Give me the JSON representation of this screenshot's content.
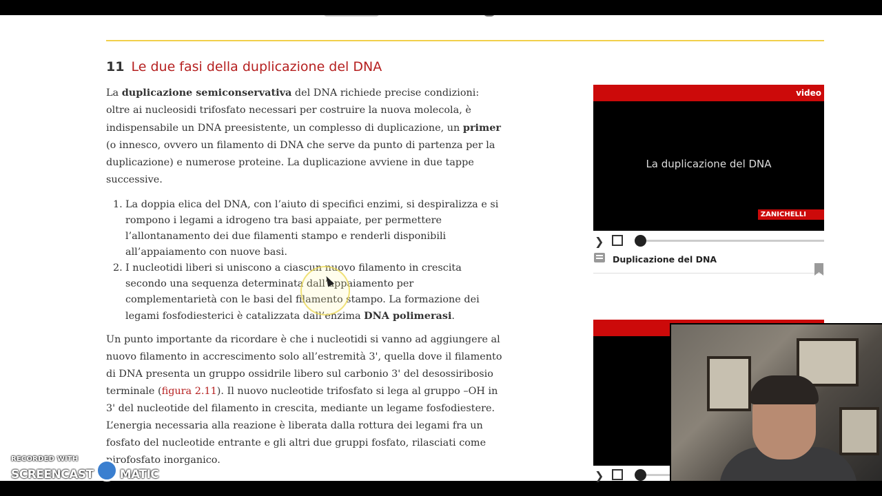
{
  "section": {
    "number": "11",
    "title": "Le due fasi della duplicazione del DNA"
  },
  "intro": {
    "part1": "La ",
    "bold1": "duplicazione semiconservativa",
    "part2": " del DNA richiede precise condizioni: oltre ai nucleosidi trifosfato necessari per costruire la nuova molecola, è indispensabile un DNA preesistente, un complesso di duplicazione, un ",
    "bold2": "primer",
    "part3": " (o innesco, ovvero un filamento di DNA che serve da punto di partenza per la duplicazione) e numerose proteine. La duplicazione avviene in due tappe successive."
  },
  "steps": [
    {
      "num": "1.",
      "text": "La doppia elica del DNA, con l’aiuto di specifici enzimi, si despiralizza e si rompono i legami a idrogeno tra basi appaiate, per permettere l’allontanamento dei due filamenti stampo e renderli disponibili all’appaiamento con nuove basi."
    },
    {
      "num": "2.",
      "text": "I nucleotidi liberi si uniscono a ciascun nuovo filamento in crescita secondo una sequenza determinata dall’appaiamento per complementarietà con le basi del filamento stampo. La formazione dei legami fosfodiesterici è catalizzata dall’enzima ",
      "bold": "DNA polimerasi",
      "end": "."
    }
  ],
  "para2": {
    "part1": "Un punto importante da ricordare è che i nucleotidi si vanno ad aggiungere al nuovo filamento in accrescimento solo all’estremità 3', quella dove il filamento di DNA presenta un gruppo ossidrile libero sul carbonio 3' del desossiribosio terminale (",
    "link": "figura 2.11",
    "part2": "). Il nuovo nucleotide trifosfato si lega al gruppo –OH in 3' del nucleotide del filamento in crescita, mediante un legame fosfodiestere. L’energia necessaria alla reazione è liberata dalla rottura dei legami fra un fosfato del nucleotide entrante e gli altri due gruppi fosfato, rilasciati come pirofosfato inorganico."
  },
  "video1": {
    "tag": "video",
    "screen_title": "La duplicazione del DNA",
    "brand": "ZANICHELLI",
    "play_glyph": "❯",
    "caption": "Duplicazione del DNA",
    "progress": 0
  },
  "video2": {
    "play_glyph": "❯",
    "progress": 0
  },
  "watermark": {
    "top": "RECORDED WITH",
    "left": "SCREENCAST",
    "right": "MATIC"
  },
  "colors": {
    "accent_red": "#cc0a0a",
    "title_red": "#b51f1f",
    "rule_yellow": "#f1cf4a"
  },
  "icons": [
    "play-icon",
    "stop-icon",
    "video-caption-icon",
    "bookmark-icon",
    "mouse-cursor-icon",
    "screencast-logo-icon"
  ]
}
